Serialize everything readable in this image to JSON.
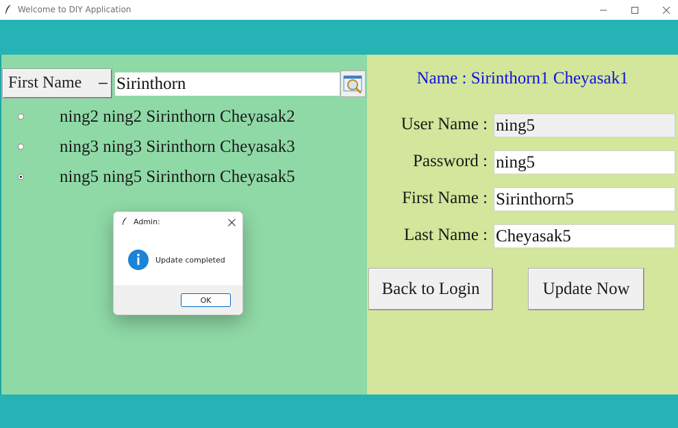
{
  "window": {
    "title": "Welcome to DIY Application",
    "minimize_glyph": "—",
    "maximize_glyph": "☐",
    "close_glyph": "✕"
  },
  "search": {
    "field_option": "First Name",
    "query": "Sirinthorn",
    "icon": "magnifier-icon"
  },
  "results": [
    {
      "label": "ning2 ning2 Sirinthorn Cheyasak2",
      "selected": false
    },
    {
      "label": "ning3 ning3 Sirinthorn Cheyasak3",
      "selected": false
    },
    {
      "label": "ning5 ning5 Sirinthorn Cheyasak5",
      "selected": true
    }
  ],
  "dialog": {
    "title": "Admin:",
    "message": "Update completed",
    "ok_label": "OK",
    "icon": "info-icon"
  },
  "profile": {
    "heading": "Name : Sirinthorn1  Cheyasak1",
    "username_label": "User Name :",
    "username_value": "ning5",
    "password_label": "Password :",
    "password_value": "ning5",
    "firstname_label": "First Name :",
    "firstname_value": "Sirinthorn5",
    "lastname_label": "Last Name :",
    "lastname_value": "Cheyasak5",
    "back_label": "Back to Login",
    "update_label": "Update Now"
  },
  "colors": {
    "band": "#26b3b5",
    "left_panel": "#8fd9a6",
    "right_panel": "#d3e69b",
    "heading": "#1010e0",
    "dialog_accent": "#0067c0"
  }
}
